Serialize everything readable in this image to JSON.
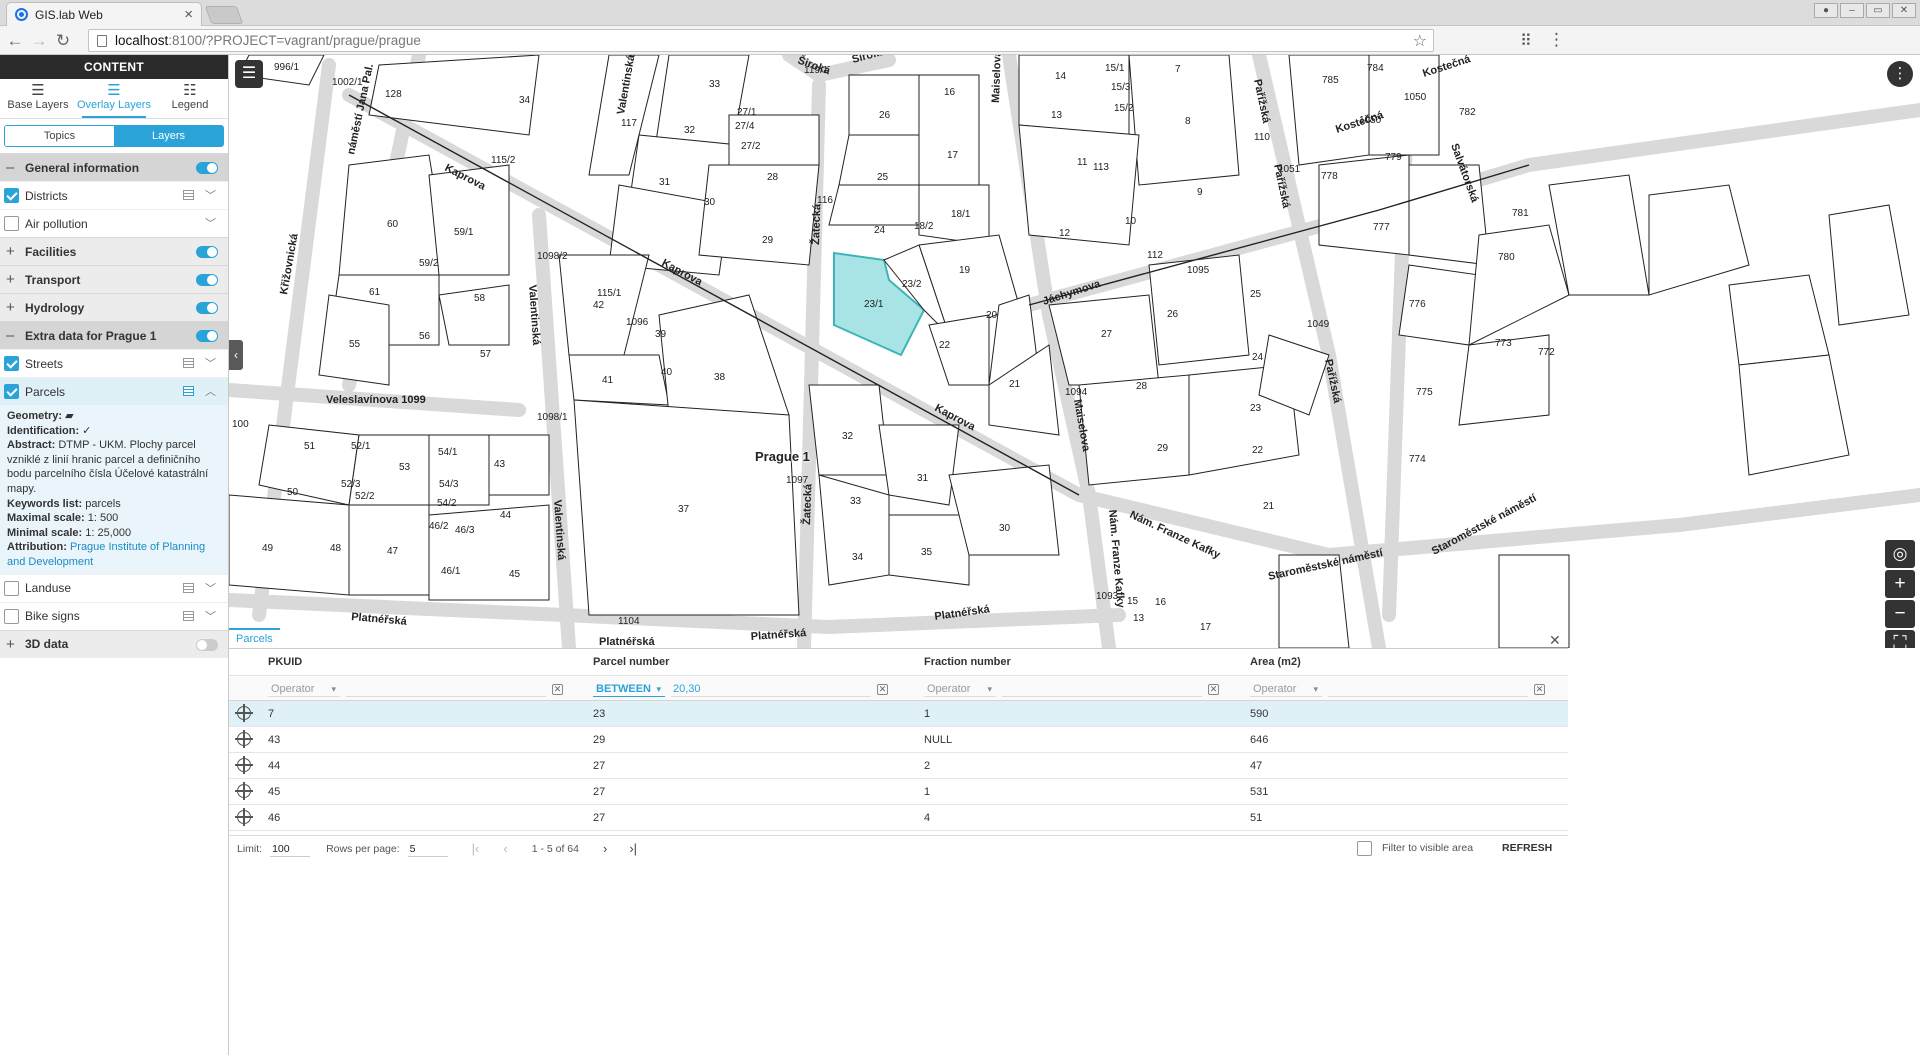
{
  "browser": {
    "tab_title": "GIS.lab Web",
    "tab_close": "×",
    "url_host": "localhost",
    "url_rest": ":8100/?PROJECT=vagrant/prague/prague"
  },
  "sidebar": {
    "header": "CONTENT",
    "tabs": [
      {
        "label": "Base Layers",
        "icon": "layers-icon"
      },
      {
        "label": "Overlay Layers",
        "icon": "stack-icon"
      },
      {
        "label": "Legend",
        "icon": "list-icon"
      }
    ],
    "segments": [
      "Topics",
      "Layers"
    ],
    "groups": {
      "general": "General information",
      "facilities": "Facilities",
      "transport": "Transport",
      "hydrology": "Hydrology",
      "extra": "Extra data for Prague 1",
      "data3d": "3D data"
    },
    "layers": {
      "districts": "Districts",
      "air": "Air pollution",
      "streets": "Streets",
      "parcels": "Parcels",
      "landuse": "Landuse",
      "bike": "Bike signs"
    },
    "meta": {
      "geometry_label": "Geometry:",
      "identification_label": "Identification:",
      "abstract_label": "Abstract:",
      "abstract_text": "DTMP - UKM. Plochy parcel vzniklé z linií hranic parcel a definičního bodu parcelního čísla Účelové katastrální mapy.",
      "keywords_label": "Keywords list:",
      "keywords_text": "parcels",
      "max_label": "Maximal scale:",
      "max_text": "1: 500",
      "min_label": "Minimal scale:",
      "min_text": "1: 25,000",
      "attr_label": "Attribution:",
      "attr_text": "Prague Institute of Planning and Development"
    }
  },
  "map": {
    "city_label": "Prague 1",
    "highlight_color": "#a8e4e6"
  },
  "table": {
    "tab_label": "Parcels",
    "columns": [
      "PKUID",
      "Parcel number",
      "Fraction number",
      "Area (m2)"
    ],
    "filters": [
      {
        "operator": "Operator",
        "value": ""
      },
      {
        "operator": "BETWEEN",
        "value": "20,30"
      },
      {
        "operator": "Operator",
        "value": ""
      },
      {
        "operator": "Operator",
        "value": ""
      }
    ],
    "rows": [
      [
        "7",
        "23",
        "1",
        "590"
      ],
      [
        "43",
        "29",
        "NULL",
        "646"
      ],
      [
        "44",
        "27",
        "2",
        "47"
      ],
      [
        "45",
        "27",
        "1",
        "531"
      ],
      [
        "46",
        "27",
        "4",
        "51"
      ]
    ],
    "pager": {
      "limit_label": "Limit:",
      "limit_value": "100",
      "rows_label": "Rows per page:",
      "rows_value": "5",
      "range": "1 - 5 of 64",
      "filter_label": "Filter to visible area",
      "refresh": "REFRESH"
    }
  }
}
